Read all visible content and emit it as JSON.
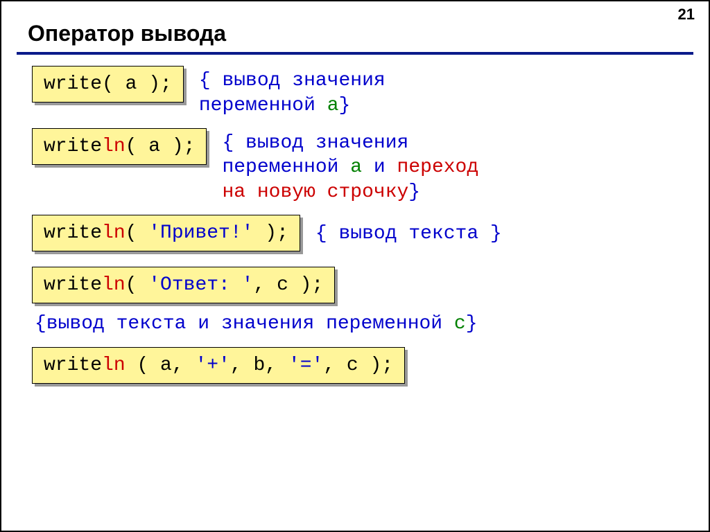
{
  "page_number": "21",
  "heading": "Оператор вывода",
  "ex1": {
    "write": "write",
    "tail": "( a );",
    "comment_l1": "{ вывод значения",
    "comment_l2_open": "переменной ",
    "comment_l2_var": "a",
    "comment_l2_close": "}"
  },
  "ex2": {
    "prefix": "write",
    "ln": "ln",
    "tail": "( a );",
    "comment_l1": "{ вывод значения",
    "comment_l2_a": "переменной ",
    "comment_l2_var": "a",
    "comment_l2_b": " и ",
    "comment_l2_red": "переход",
    "comment_l3_red": "на новую строчку",
    "comment_l3_close": "}"
  },
  "ex3": {
    "prefix": "write",
    "ln": "ln",
    "mid_a": "( ",
    "str": "'Привет!'",
    "mid_b": " );",
    "comment": "{ вывод текста }"
  },
  "ex4": {
    "prefix": "write",
    "ln": "ln",
    "mid_a": "( ",
    "str": "'Ответ: '",
    "mid_b": ", c );",
    "comment_a": "{вывод текста и значения переменной ",
    "comment_var": "c",
    "comment_b": "}"
  },
  "ex5": {
    "prefix": "write",
    "ln": "ln",
    "a": " ( a, ",
    "s1": "'+'",
    "b": ", b, ",
    "s2": "'='",
    "c": ", c );"
  }
}
